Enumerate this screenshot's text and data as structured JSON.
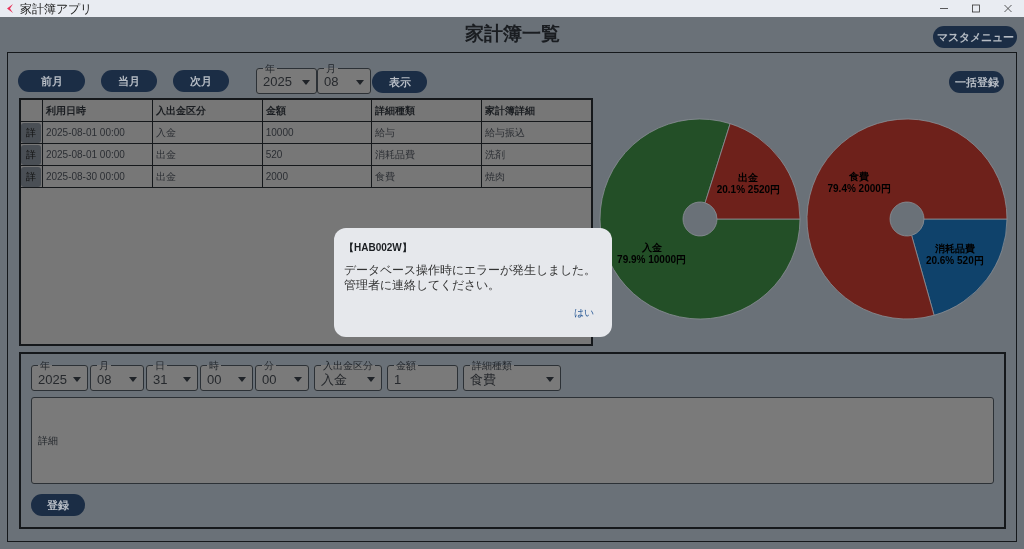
{
  "window": {
    "title": "家計簿アプリ"
  },
  "page_title": "家計簿一覧",
  "master_menu_button": "マスタメニュー",
  "nav_buttons": [
    "前月",
    "当月",
    "次月"
  ],
  "period": {
    "year": {
      "label": "年",
      "value": "2025"
    },
    "month": {
      "label": "月",
      "value": "08"
    }
  },
  "show_button": "表示",
  "bulk_button": "一括登録",
  "table": {
    "columns": [
      "利用日時",
      "入出金区分",
      "金額",
      "詳細種類",
      "家計簿詳細"
    ],
    "rows": [
      {
        "detail_button": "詳",
        "cells": [
          "2025-08-01 00:00",
          "入金",
          "10000",
          "給与",
          "給与振込"
        ]
      },
      {
        "detail_button": "詳",
        "cells": [
          "2025-08-01 00:00",
          "出金",
          "520",
          "消耗品費",
          "洗剤"
        ]
      },
      {
        "detail_button": "詳",
        "cells": [
          "2025-08-30 00:00",
          "出金",
          "2000",
          "食費",
          "焼肉"
        ]
      }
    ]
  },
  "charts": [
    {
      "chart_data": {
        "type": "donut",
        "categories": [
          "入金",
          "出金"
        ],
        "values": [
          10000,
          2520
        ],
        "colors": [
          "#234f27",
          "#6e211b"
        ],
        "value_labels": [
          "79.9% 10000円",
          "20.1% 2520円"
        ]
      }
    },
    {
      "chart_data": {
        "type": "donut",
        "categories": [
          "消耗品費",
          "食費"
        ],
        "values": [
          520,
          2000
        ],
        "colors": [
          "#0f426b",
          "#6e211b"
        ],
        "value_labels": [
          "20.6% 520円",
          "79.4% 2000円"
        ]
      }
    }
  ],
  "form": {
    "fields": [
      {
        "kind": "select",
        "label": "年",
        "value": "2025"
      },
      {
        "kind": "select",
        "label": "月",
        "value": "08"
      },
      {
        "kind": "select",
        "label": "日",
        "value": "31"
      },
      {
        "kind": "select",
        "label": "時",
        "value": "00"
      },
      {
        "kind": "select",
        "label": "分",
        "value": "00"
      },
      {
        "kind": "select",
        "label": "入出金区分",
        "value": "入金"
      },
      {
        "kind": "text",
        "label": "金額",
        "value": "1"
      },
      {
        "kind": "select",
        "label": "詳細種類",
        "value": "食費"
      }
    ],
    "detail": {
      "placeholder": "詳細"
    },
    "submit_button": "登録"
  },
  "dialog": {
    "title": "【HAB002W】",
    "message": [
      "データベース操作時にエラーが発生しました。",
      "管理者に連絡してください。"
    ],
    "button": "はい"
  }
}
